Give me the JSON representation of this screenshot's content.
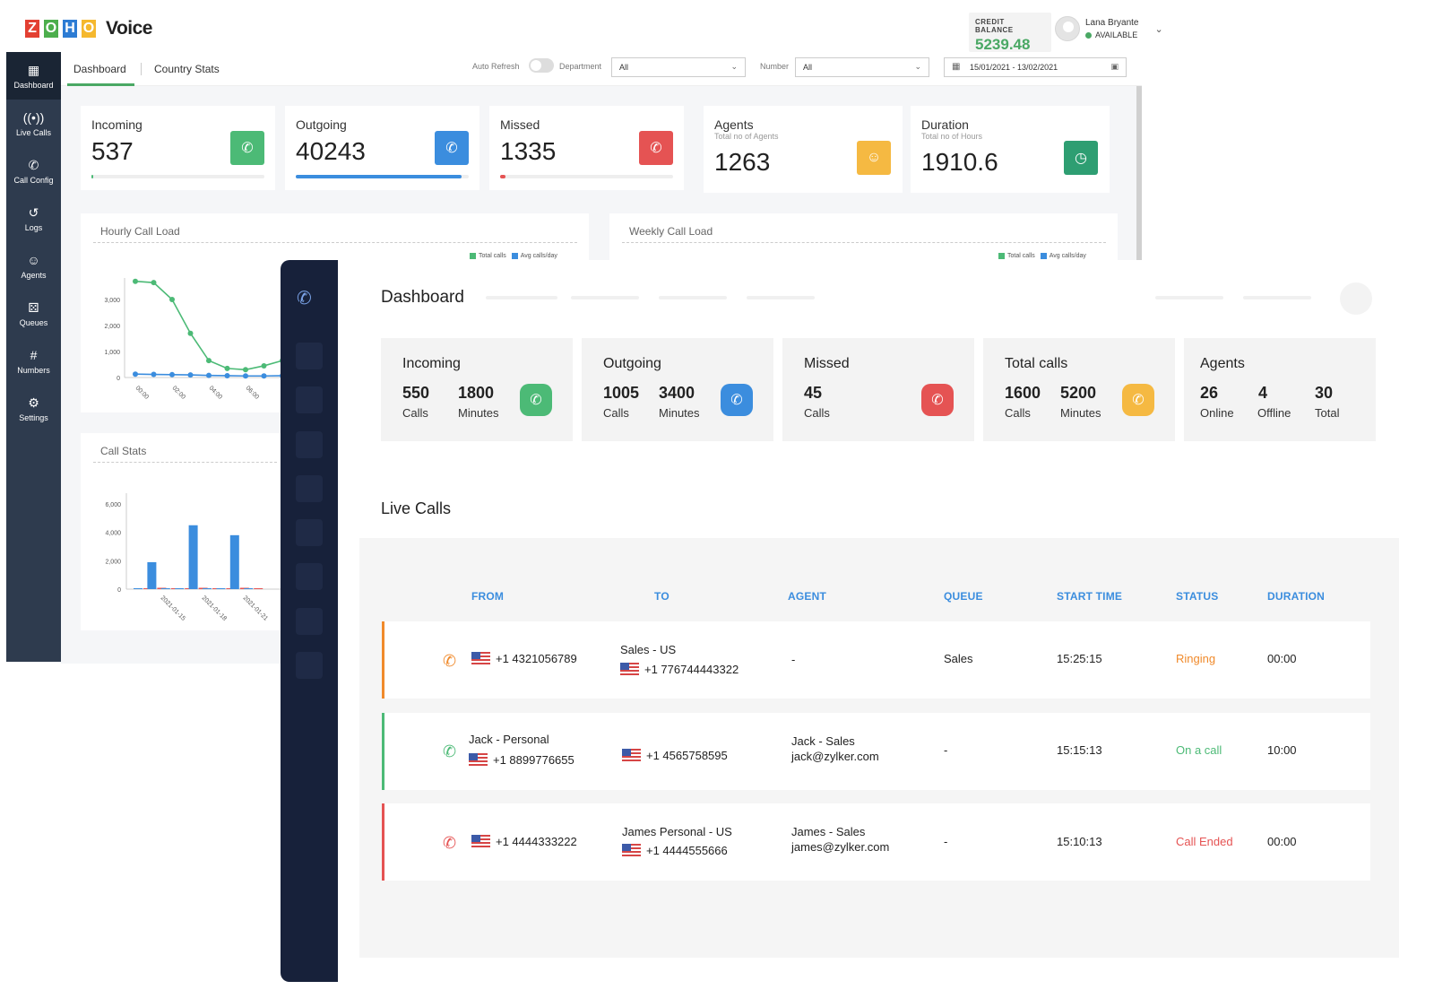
{
  "back": {
    "logo_letters": [
      "Z",
      "O",
      "H",
      "O"
    ],
    "logo_colors": [
      "#e34032",
      "#4cae4c",
      "#2d7cd4",
      "#f5b82e"
    ],
    "logo_word": "Voice",
    "credit": {
      "label": "CREDIT BALANCE",
      "value": "5239.48"
    },
    "user": {
      "name": "Lana Bryante",
      "status": "AVAILABLE"
    },
    "sidebar": [
      {
        "label": "Dashboard",
        "icon": "grid-icon"
      },
      {
        "label": "Live Calls",
        "icon": "broadcast-icon"
      },
      {
        "label": "Call Config",
        "icon": "phone-icon"
      },
      {
        "label": "Logs",
        "icon": "history-icon"
      },
      {
        "label": "Agents",
        "icon": "person-icon"
      },
      {
        "label": "Queues",
        "icon": "group-icon"
      },
      {
        "label": "Numbers",
        "icon": "hash-icon"
      },
      {
        "label": "Settings",
        "icon": "gear-icon"
      }
    ],
    "tabs": [
      "Dashboard",
      "Country Stats"
    ],
    "filters": {
      "auto_refresh": "Auto Refresh",
      "department_label": "Department",
      "department_value": "All",
      "number_label": "Number",
      "number_value": "All",
      "date_range": "15/01/2021 - 13/02/2021"
    },
    "stats": [
      {
        "title": "Incoming",
        "value": "537",
        "color": "#4cba76",
        "progress": 0.01
      },
      {
        "title": "Outgoing",
        "value": "40243",
        "color": "#3b8dde",
        "progress": 0.96
      },
      {
        "title": "Missed",
        "value": "1335",
        "color": "#e55353",
        "progress": 0.03
      },
      {
        "title": "Agents",
        "subtitle": "Total no of Agents",
        "value": "1263",
        "color": "#f5b942"
      },
      {
        "title": "Duration",
        "subtitle": "Total no of Hours",
        "value": "1910.6",
        "color": "#2e9e72"
      }
    ],
    "hourly": {
      "title": "Hourly Call Load",
      "legend": [
        "Total calls",
        "Avg calls/day"
      ],
      "y_ticks": [
        "3,000",
        "2,000",
        "1,000",
        "0"
      ],
      "x_ticks": [
        "00:00",
        "02:00",
        "04:00",
        "06:00"
      ]
    },
    "weekly": {
      "title": "Weekly Call Load",
      "legend": [
        "Total calls",
        "Avg calls/day"
      ]
    },
    "callstats": {
      "title": "Call Stats",
      "y_ticks": [
        "6,000",
        "4,000",
        "2,000",
        "0"
      ],
      "x_ticks": [
        "2021-01-15",
        "2021-01-18",
        "2021-01-21"
      ]
    }
  },
  "chart_data": [
    {
      "type": "line",
      "title": "Hourly Call Load",
      "ylim": [
        0,
        3500
      ],
      "x": [
        0,
        1,
        2,
        3,
        4,
        5,
        6,
        7,
        8
      ],
      "series": [
        {
          "name": "Total calls",
          "values": [
            3700,
            3650,
            3000,
            1700,
            650,
            350,
            300,
            450,
            650
          ]
        },
        {
          "name": "Avg calls/day",
          "values": [
            130,
            120,
            110,
            100,
            80,
            70,
            60,
            60,
            70
          ]
        }
      ]
    },
    {
      "type": "bar",
      "title": "Call Stats",
      "ylim": [
        0,
        6000
      ],
      "categories": [
        "2021-01-14",
        "2021-01-15",
        "2021-01-16",
        "2021-01-17",
        "2021-01-18",
        "2021-01-19",
        "2021-01-20",
        "2021-01-21",
        "2021-01-22"
      ],
      "series": [
        {
          "name": "Incoming",
          "values": [
            0,
            1900,
            0,
            0,
            4500,
            0,
            0,
            3800,
            0
          ]
        },
        {
          "name": "Missed",
          "values": [
            0,
            40,
            0,
            0,
            80,
            0,
            0,
            60,
            0
          ]
        }
      ]
    }
  ],
  "front": {
    "title": "Dashboard",
    "cards": [
      {
        "title": "Incoming",
        "nums": [
          {
            "n": "550",
            "u": "Calls"
          },
          {
            "n": "1800",
            "u": "Minutes"
          }
        ],
        "color": "#4cba76",
        "icon": "incoming-call-icon"
      },
      {
        "title": "Outgoing",
        "nums": [
          {
            "n": "1005",
            "u": "Calls"
          },
          {
            "n": "3400",
            "u": "Minutes"
          }
        ],
        "color": "#3b8dde",
        "icon": "outgoing-call-icon"
      },
      {
        "title": "Missed",
        "nums": [
          {
            "n": "45",
            "u": "Calls"
          }
        ],
        "color": "#e55353",
        "icon": "missed-call-icon"
      },
      {
        "title": "Total calls",
        "nums": [
          {
            "n": "1600",
            "u": "Calls"
          },
          {
            "n": "5200",
            "u": "Minutes"
          }
        ],
        "color": "#f5b942",
        "icon": "phone-icon"
      },
      {
        "title": "Agents",
        "nums": [
          {
            "n": "26",
            "u": "Online"
          },
          {
            "n": "4",
            "u": "Offline"
          },
          {
            "n": "30",
            "u": "Total"
          }
        ]
      }
    ],
    "live_calls_title": "Live Calls",
    "headers": [
      "FROM",
      "TO",
      "AGENT",
      "QUEUE",
      "START TIME",
      "STATUS",
      "DURATION"
    ],
    "rows": [
      {
        "from_name": "",
        "from": "+1 4321056789",
        "to_name": "Sales - US",
        "to": "+1 776744443322",
        "agent_name": "-",
        "agent_email": "",
        "queue": "Sales",
        "start": "15:25:15",
        "status": "Ringing",
        "duration": "00:00",
        "color": "#f08a2b",
        "icon": "incoming-ringing-icon"
      },
      {
        "from_name": "Jack - Personal",
        "from": "+1 8899776655",
        "to_name": "",
        "to": "+1 4565758595",
        "agent_name": "Jack - Sales",
        "agent_email": "jack@zylker.com",
        "queue": "-",
        "start": "15:15:13",
        "status": "On a call",
        "duration": "10:00",
        "color": "#4cba76",
        "icon": "outgoing-active-icon"
      },
      {
        "from_name": "",
        "from": "+1 4444333222",
        "to_name": "James Personal - US",
        "to": "+1 4444555666",
        "agent_name": "James - Sales",
        "agent_email": "james@zylker.com",
        "queue": "-",
        "start": "15:10:13",
        "status": "Call Ended",
        "duration": "00:00",
        "color": "#e55353",
        "icon": "call-ended-icon"
      }
    ]
  }
}
